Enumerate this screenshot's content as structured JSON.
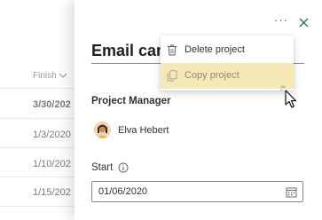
{
  "grid": {
    "column_header": "Finish",
    "rows": [
      "3/30/202",
      "1/3/2020",
      "1/10/202",
      "1/15/202"
    ]
  },
  "panel": {
    "title": "Email cam",
    "project_manager_label": "Project Manager",
    "project_manager_name": "Elva Hebert",
    "start_label": "Start",
    "start_value": "01/06/2020"
  },
  "menu": {
    "items": [
      {
        "label": "Delete project",
        "icon": "trash-icon"
      },
      {
        "label": "Copy project",
        "icon": "copy-icon"
      }
    ]
  },
  "toolbar": {
    "more_label": "···"
  },
  "colors": {
    "accent": "#107c41",
    "menu_highlight": "#f7e9b5"
  }
}
